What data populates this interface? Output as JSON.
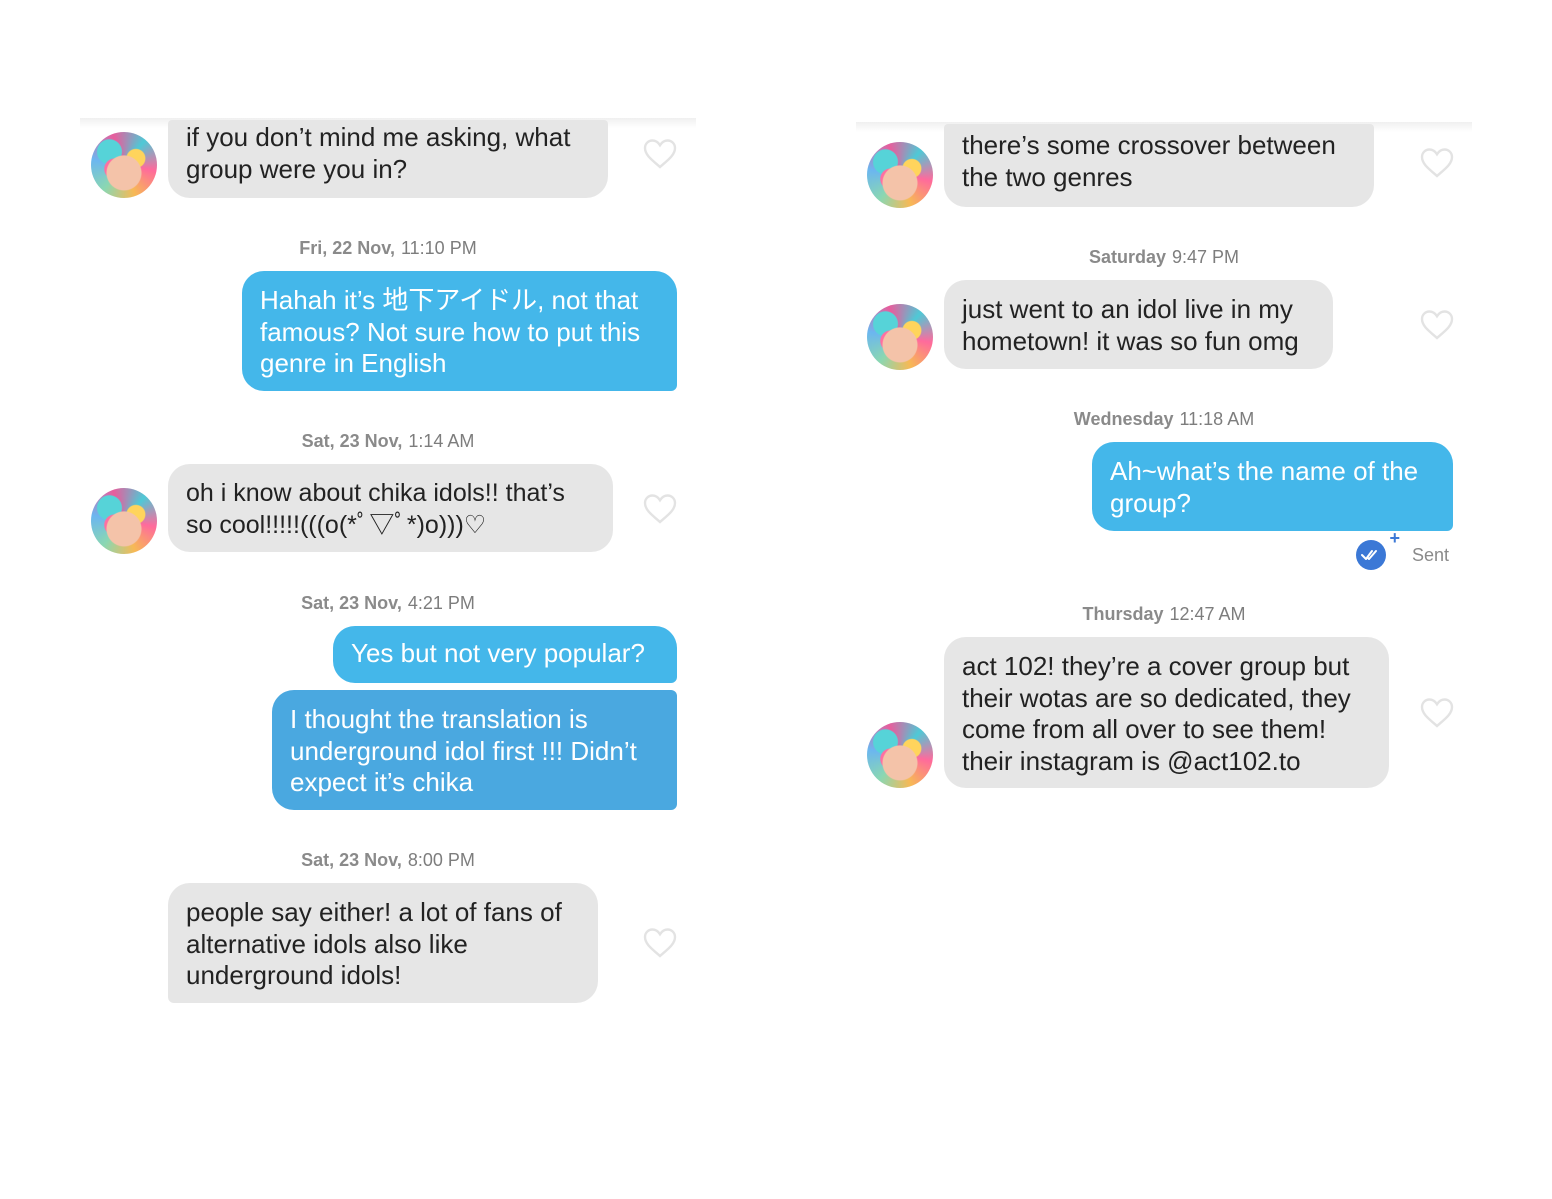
{
  "left": {
    "items": [
      {
        "text": "if you don’t mind me asking, what group were you in?"
      },
      {
        "day": "Fri, 22 Nov,",
        "time": "11:10 PM"
      },
      {
        "text": "Hahah it’s 地下アイドル, not that famous? Not sure how to put this genre in English"
      },
      {
        "day": "Sat, 23 Nov,",
        "time": "1:14 AM"
      },
      {
        "text": "oh i know about chika idols!! that’s so cool!!!!!(((o(*ﾟ▽ﾟ*)o)))♡"
      },
      {
        "day": "Sat, 23 Nov,",
        "time": "4:21 PM"
      },
      {
        "text": "Yes but not very popular?"
      },
      {
        "text": "I thought the translation is underground idol first !!! Didn’t expect it’s chika"
      },
      {
        "day": "Sat, 23 Nov,",
        "time": "8:00 PM"
      },
      {
        "text": "people say either! a lot of fans of alternative idols also like underground idols!"
      }
    ]
  },
  "right": {
    "items": [
      {
        "text": "there’s some crossover between the two genres"
      },
      {
        "day": "Saturday",
        "time": "9:47 PM"
      },
      {
        "text": "just went to an idol live in my hometown! it was so fun omg"
      },
      {
        "day": "Wednesday",
        "time": "11:18 AM"
      },
      {
        "text": "Ah~what’s the name of the group?"
      },
      {
        "status": "Sent"
      },
      {
        "day": "Thursday",
        "time": "12:47 AM"
      },
      {
        "text": "act 102! they’re a cover group but their wotas are so dedicated, they come from all over to see them! their instagram is @act102.to"
      }
    ]
  },
  "colors": {
    "incoming_bubble": "#e6e6e6",
    "outgoing_bubble": "#44b7ea",
    "read_receipt": "#3b78d6"
  },
  "icons": {
    "like": "heart-outline-icon",
    "read": "double-check-icon"
  }
}
